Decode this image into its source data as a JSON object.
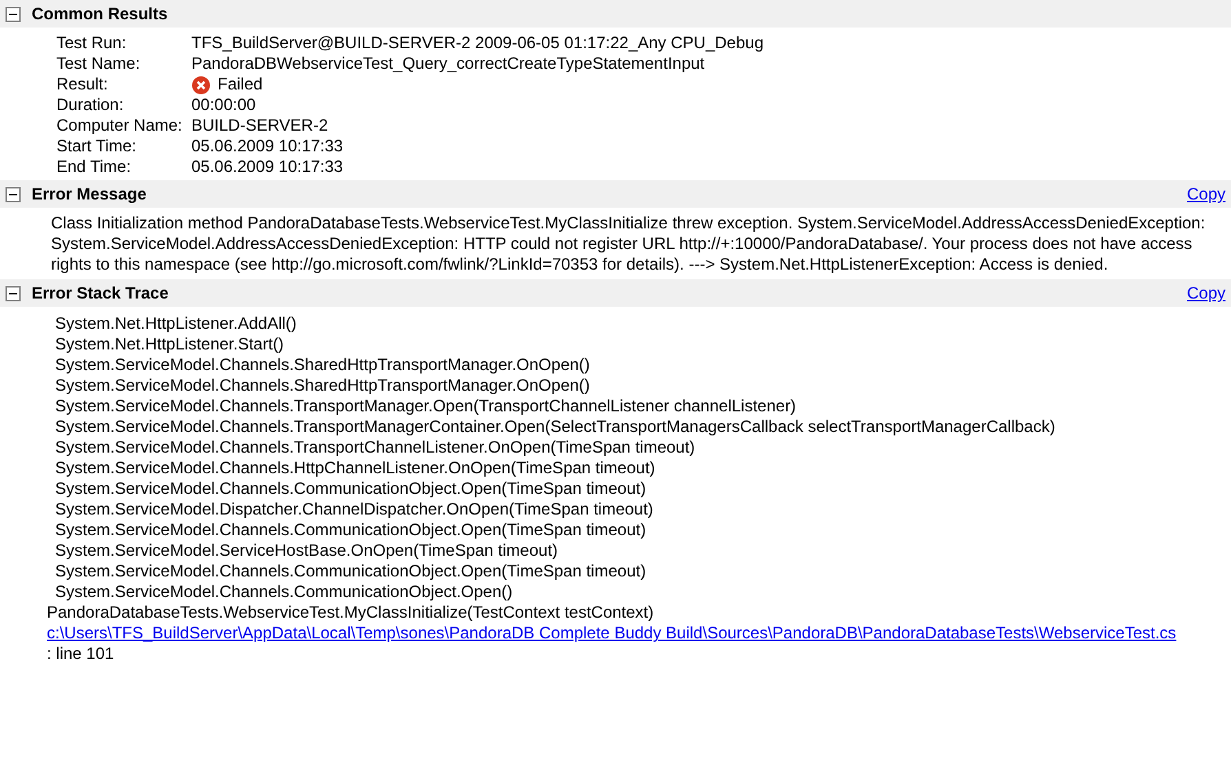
{
  "sections": [
    {
      "kind": "fields",
      "title": "Common Results",
      "expanded": true,
      "fields": [
        {
          "kind": "plain",
          "label": "Test Run:",
          "value": "TFS_BuildServer@BUILD-SERVER-2 2009-06-05 01:17:22_Any CPU_Debug"
        },
        {
          "kind": "plain",
          "label": "Test Name:",
          "value": "PandoraDBWebserviceTest_Query_correctCreateTypeStatementInput"
        },
        {
          "kind": "failed",
          "label": "Result:",
          "value": "Failed"
        },
        {
          "kind": "plain",
          "label": "Duration:",
          "value": "00:00:00"
        },
        {
          "kind": "plain",
          "label": "Computer Name:",
          "value": "BUILD-SERVER-2"
        },
        {
          "kind": "plain",
          "label": "Start Time:",
          "value": "05.06.2009 10:17:33"
        },
        {
          "kind": "plain",
          "label": "End Time:",
          "value": "05.06.2009 10:17:33"
        }
      ]
    },
    {
      "kind": "message",
      "title": "Error Message",
      "expanded": true,
      "copy": "Copy",
      "text": "Class Initialization method PandoraDatabaseTests.WebserviceTest.MyClassInitialize threw exception. System.ServiceModel.AddressAccessDeniedException: System.ServiceModel.AddressAccessDeniedException: HTTP could not register URL http://+:10000/PandoraDatabase/. Your process does not have access rights to this namespace (see http://go.microsoft.com/fwlink/?LinkId=70353 for details). --->  System.Net.HttpListenerException: Access is denied."
    },
    {
      "kind": "trace",
      "title": "Error Stack Trace",
      "expanded": true,
      "copy": "Copy",
      "lines": [
        {
          "kind": "frame",
          "text": "System.Net.HttpListener.AddAll()"
        },
        {
          "kind": "frame",
          "text": "System.Net.HttpListener.Start()"
        },
        {
          "kind": "frame",
          "text": "System.ServiceModel.Channels.SharedHttpTransportManager.OnOpen()"
        },
        {
          "kind": "frame",
          "text": "System.ServiceModel.Channels.SharedHttpTransportManager.OnOpen()"
        },
        {
          "kind": "frame",
          "text": "System.ServiceModel.Channels.TransportManager.Open(TransportChannelListener channelListener)"
        },
        {
          "kind": "frame",
          "text": "System.ServiceModel.Channels.TransportManagerContainer.Open(SelectTransportManagersCallback selectTransportManagerCallback)"
        },
        {
          "kind": "frame",
          "text": "System.ServiceModel.Channels.TransportChannelListener.OnOpen(TimeSpan timeout)"
        },
        {
          "kind": "frame",
          "text": "System.ServiceModel.Channels.HttpChannelListener.OnOpen(TimeSpan timeout)"
        },
        {
          "kind": "frame",
          "text": "System.ServiceModel.Channels.CommunicationObject.Open(TimeSpan timeout)"
        },
        {
          "kind": "frame",
          "text": "System.ServiceModel.Dispatcher.ChannelDispatcher.OnOpen(TimeSpan timeout)"
        },
        {
          "kind": "frame",
          "text": "System.ServiceModel.Channels.CommunicationObject.Open(TimeSpan timeout)"
        },
        {
          "kind": "frame",
          "text": "System.ServiceModel.ServiceHostBase.OnOpen(TimeSpan timeout)"
        },
        {
          "kind": "frame",
          "text": "System.ServiceModel.Channels.CommunicationObject.Open(TimeSpan timeout)"
        },
        {
          "kind": "frame",
          "text": "System.ServiceModel.Channels.CommunicationObject.Open()"
        },
        {
          "kind": "method",
          "text": "PandoraDatabaseTests.WebserviceTest.MyClassInitialize(TestContext testContext)"
        },
        {
          "kind": "link",
          "text": "c:\\Users\\TFS_BuildServer\\AppData\\Local\\Temp\\sones\\PandoraDB Complete Buddy Build\\Sources\\PandoraDB\\PandoraDatabaseTests\\WebserviceTest.cs"
        },
        {
          "kind": "method",
          "text": ": line 101"
        }
      ]
    }
  ]
}
